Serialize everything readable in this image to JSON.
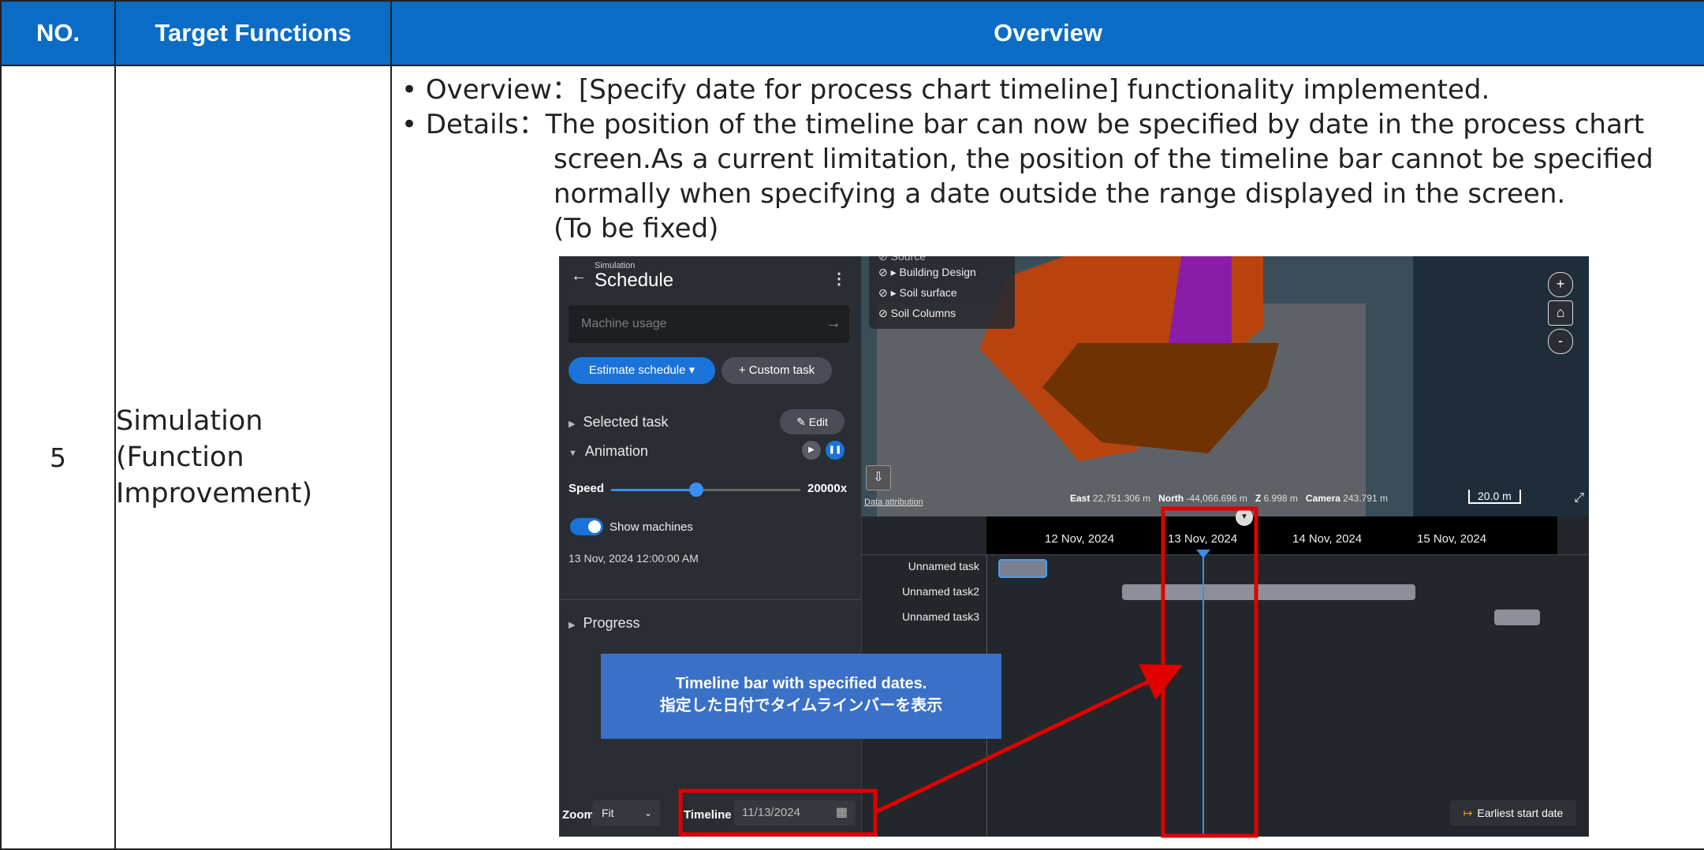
{
  "table": {
    "headers": [
      "NO.",
      "Target Functions",
      "Overview"
    ],
    "row": {
      "no": "5",
      "target_lines": [
        "Simulation",
        "(Function",
        "Improvement)"
      ],
      "overview_lines": [
        "• Overview：[Specify date for process chart timeline] functionality implemented.",
        "• Details：The position of the timeline bar can now be specified by date in the process chart",
        "screen.As a current limitation, the position of the timeline bar cannot be specified",
        "normally when specifying a date outside the range displayed in the screen.",
        "(To be fixed)"
      ]
    }
  },
  "screenshot": {
    "sidebar": {
      "breadcrumb": "Simulation",
      "back_icon": "arrow-left-icon",
      "title": "Schedule",
      "menu_icon": "kebab-icon",
      "machine_placeholder": "Machine usage",
      "estimate_label": "Estimate schedule ▾",
      "custom_task_label": "+ Custom task",
      "selected_task_label": "Selected task",
      "edit_label": "✎ Edit",
      "animation_label": "Animation",
      "speed_label": "Speed",
      "speed_value": "20000x",
      "speed_fraction": 0.45,
      "show_machines_label": "Show machines",
      "show_machines_on": true,
      "current_time": "13 Nov, 2024 12:00:00 AM",
      "progress_label": "Progress"
    },
    "map": {
      "layers": [
        "Source",
        "Building Design",
        "Soil surface",
        "Soil Columns"
      ],
      "zoom_in": "+",
      "zoom_out": "-",
      "home_icon": "home-icon",
      "attribution": "Data attribution",
      "east_label": "East",
      "east_value": "22,751.306 m",
      "north_label": "North",
      "north_value": "-44,066.696 m",
      "z_label": "Z",
      "z_value": "6.998 m",
      "camera_label": "Camera",
      "camera_value": "243.791 m",
      "scale": "20.0 m"
    },
    "timeline": {
      "dates": [
        "12 Nov, 2024",
        "13 Nov, 2024",
        "14 Nov, 2024",
        "15 Nov, 2024"
      ],
      "tasks": [
        "Unnamed task",
        "Unnamed task2",
        "Unnamed task3"
      ],
      "zoom_label": "Zoom",
      "zoom_value": "Fit",
      "timeline_label": "Timeline",
      "timeline_value": "11/13/2024",
      "earliest_label": "Earliest start date"
    },
    "callout": {
      "line1": "Timeline bar with specified dates.",
      "line2": "指定した日付でタイムラインバーを表示"
    },
    "colors": {
      "header_bg": "#0a6cc4",
      "accent": "#1a73d9",
      "highlight": "#e00000",
      "callout_bg": "#3a70c6"
    }
  }
}
